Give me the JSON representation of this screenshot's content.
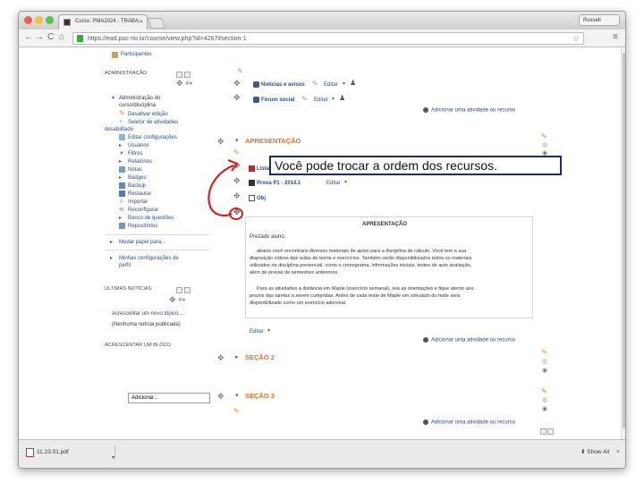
{
  "browser": {
    "tab_title": "Curso: PMA2024 - TRABA...",
    "tab_close": "×",
    "user_label": "Russell",
    "url": "https://ead.puc-rio.br/course/view.php?id=4267#section-1",
    "back": "←",
    "forward": "→",
    "reload": "C",
    "home": "⌂",
    "star": "☆",
    "menu": "≡"
  },
  "sidebar": {
    "participants": "Participantes",
    "admin_title": "ADMINISTRAÇÃO",
    "admin_items": {
      "course_admin_line1": "Administração do",
      "course_admin_line2": "curso/disciplina",
      "edit_off": "Desativar edição",
      "activity_selector_line1": "Seletor de atividades",
      "activity_selector_line2": "desabilitado",
      "edit_settings": "Editar configurações",
      "users": "Usuários",
      "filters": "Filtros",
      "reports": "Relatórios",
      "grades": "Notas",
      "badges": "Badges",
      "backup": "Backup",
      "restore": "Restaurar",
      "import": "Importar",
      "reset": "Reconfigurar",
      "question_bank": "Banco de questões",
      "repositories": "Repositórios"
    },
    "switch_role": "Mudar papel para...",
    "profile_settings_line1": "Minhas configurações de",
    "profile_settings_line2": "perfil",
    "news_title": "ÚLTIMAS NOTÍCIAS",
    "add_topic": "Acrescentar um novo tópico...",
    "no_news": "(Nenhuma notícia publicada)",
    "add_block_title": "ACRESCENTAR UM BLOCO",
    "add_block_select": "Adicionar..."
  },
  "main": {
    "news_forum": "Notícias e avisos",
    "social_forum": "Fórum social",
    "edit_label": "Editar",
    "add_activity": "Adicionar uma atividade ou recurso",
    "section1_title": "APRESENTAÇÃO",
    "resource1": "Lista 05",
    "resource2": "Prova P1 - 2014.1",
    "resource3": "Obj",
    "summary_title": "APRESENTAÇÃO",
    "summary_greeting": "Prezado aluno,",
    "summary_p1_l1": "abaixo você encontrará diversos materiais de apoio para a disciplina de cálculo. Você tem a sua",
    "summary_p1_l2": "disposição vídeos das aulas de teoria e exercícios. Também serão disponibilizados todos os materiais",
    "summary_p1_l3": "utilizados na disciplina presencial, como o cronograma, informações iniciais, testes de auto avaliação,",
    "summary_p1_l4": "além de provas de semestres anteriores.",
    "summary_p2_l1": "Para as atividades a distância em Maple (exercício semanal), leia as orientações e fique atento aos",
    "summary_p2_l2": "prazos das tarefas a serem cumpridas. Antes de cada teste de Maple um simulado do teste será",
    "summary_p2_l3": "disponibilizado como um exercício adicional.",
    "section2_title": "SEÇÃO 2",
    "section3_title": "SEÇÃO 3"
  },
  "callout": {
    "text": "Você pode trocar a ordem dos recursos."
  },
  "downloads": {
    "file_name": "11.23.01.pdf",
    "show_all": "Show All",
    "close": "×"
  },
  "colors": {
    "accent_orange": "#e07020",
    "link_blue": "#244f8c",
    "callout_border": "#1a2a6c",
    "arrow_red": "#d81e1e"
  }
}
